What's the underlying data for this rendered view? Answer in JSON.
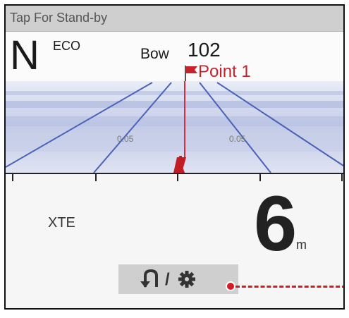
{
  "status_bar": {
    "text": "Tap For Stand-by"
  },
  "header": {
    "mode_letter": "N",
    "mode_sub": "ECO",
    "heading_label": "Bow",
    "heading_value": "102",
    "waypoint_name": "Point 1"
  },
  "highway": {
    "scale_left": "0.05",
    "scale_right": "0.05"
  },
  "xte": {
    "label": "XTE",
    "value": "6",
    "unit": "m"
  },
  "controls": {
    "u_turn_icon": "u-turn-icon",
    "separator": "/",
    "gear_icon": "gear-icon"
  },
  "colors": {
    "accent_red": "#c8232c",
    "callout_red": "#d71920",
    "status_bar_bg": "#cfcfcf",
    "highway_blue": "#4a62b8"
  }
}
